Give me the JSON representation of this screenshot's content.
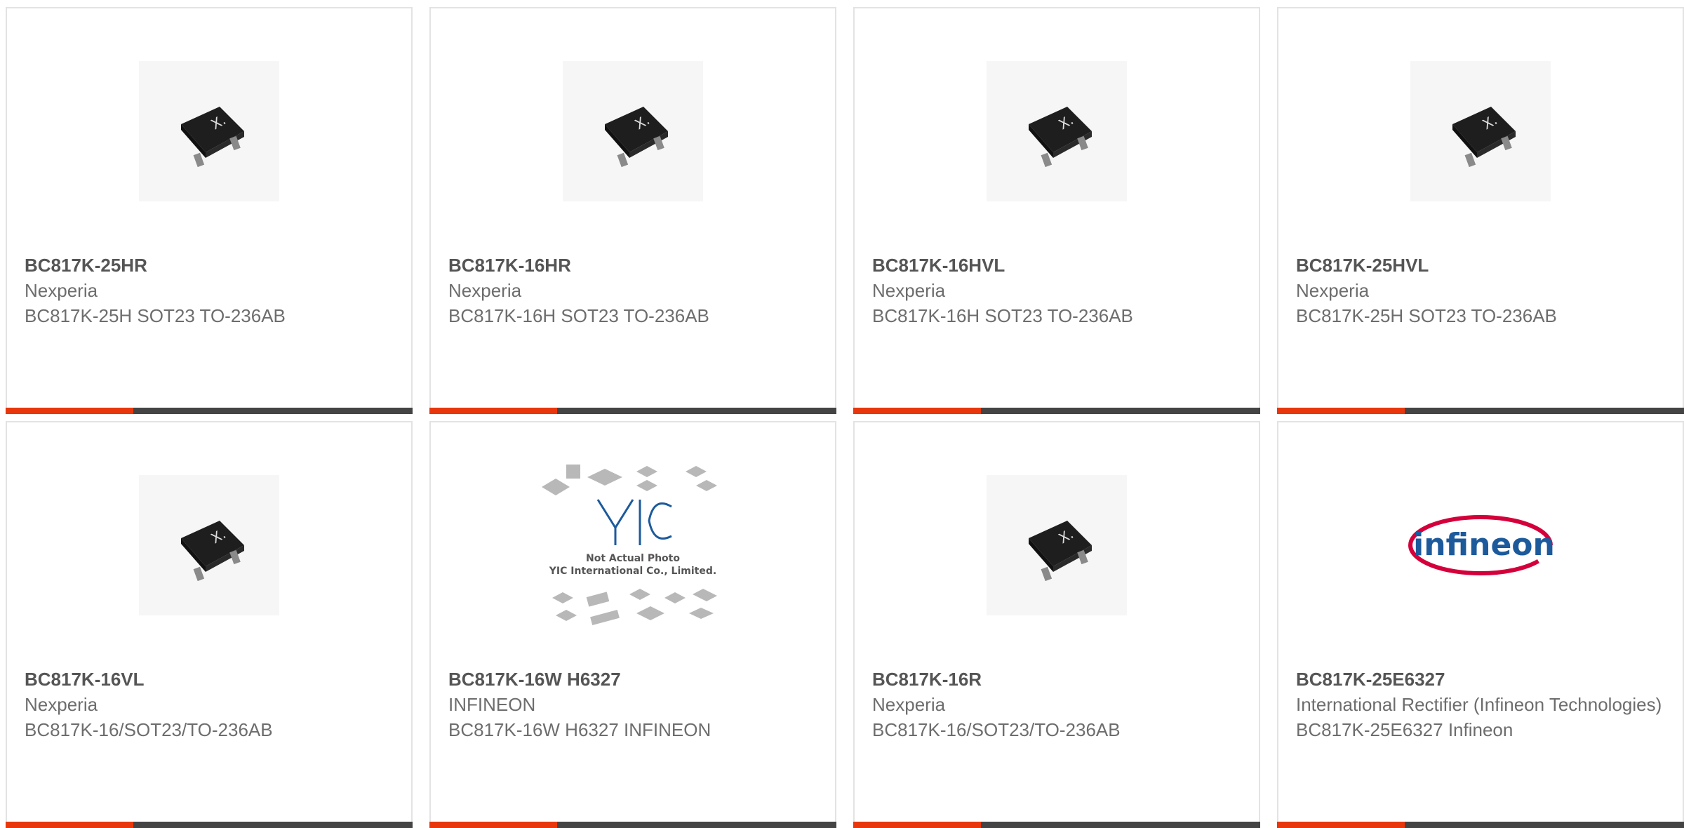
{
  "products": [
    {
      "part": "BC817K-25HR",
      "maker": "Nexperia",
      "desc": "BC817K-25H SOT23 TO-236AB",
      "image": "sot23-transistor"
    },
    {
      "part": "BC817K-16HR",
      "maker": "Nexperia",
      "desc": "BC817K-16H SOT23 TO-236AB",
      "image": "sot23-transistor"
    },
    {
      "part": "BC817K-16HVL",
      "maker": "Nexperia",
      "desc": "BC817K-16H SOT23 TO-236AB",
      "image": "sot23-transistor"
    },
    {
      "part": "BC817K-25HVL",
      "maker": "Nexperia",
      "desc": "BC817K-25H SOT23 TO-236AB",
      "image": "sot23-transistor"
    },
    {
      "part": "BC817K-16VL",
      "maker": "Nexperia",
      "desc": "BC817K-16/SOT23/TO-236AB",
      "image": "sot23-transistor"
    },
    {
      "part": "BC817K-16W H6327",
      "maker": "INFINEON",
      "desc": "BC817K-16W H6327 INFINEON",
      "image": "placeholder-yic",
      "placeholder_text": [
        "Not Actual Photo",
        "YIC International Co., Limited."
      ],
      "placeholder_logo": "YIC"
    },
    {
      "part": "BC817K-16R",
      "maker": "Nexperia",
      "desc": "BC817K-16/SOT23/TO-236AB",
      "image": "sot23-transistor"
    },
    {
      "part": "BC817K-25E6327",
      "maker": "International Rectifier (Infineon Technologies)",
      "desc": "BC817K-25E6327 Infineon",
      "image": "infineon-logo",
      "logo_text": "infineon"
    }
  ],
  "colors": {
    "accent": "#e8370c",
    "bar": "#444444",
    "border": "#e3e3e3"
  }
}
